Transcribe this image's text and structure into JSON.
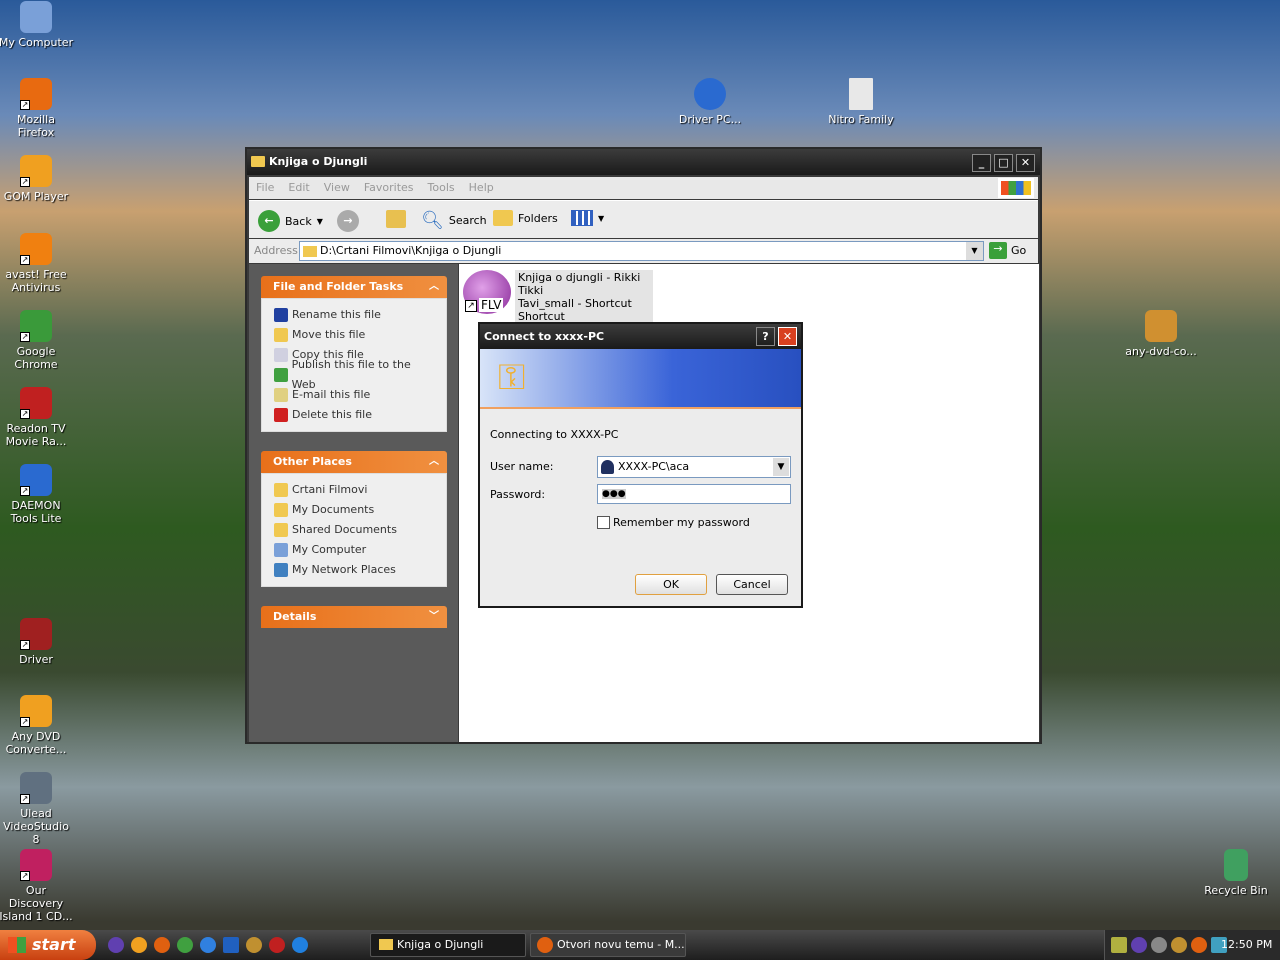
{
  "desktop": {
    "left_icons": [
      {
        "label": "My Computer",
        "color": "#7aa0d8"
      },
      {
        "label": "Mozilla Firefox",
        "color": "#e86a10"
      },
      {
        "label": "GOM Player",
        "color": "#f0a020"
      },
      {
        "label": "avast! Free Antivirus",
        "color": "#f08010"
      },
      {
        "label": "Google Chrome",
        "color": "#3a9a3a"
      },
      {
        "label": "Readon TV Movie Ra...",
        "color": "#c02020"
      },
      {
        "label": "DAEMON Tools Lite",
        "color": "#2a6ad0"
      },
      {
        "label": "Driver",
        "color": "#a02020"
      },
      {
        "label": "Any DVD Converte...",
        "color": "#f0a020"
      },
      {
        "label": "Ulead VideoStudio 8",
        "color": "#607080"
      },
      {
        "label": "Our Discovery Island 1 CD...",
        "color": "#c02060"
      }
    ],
    "other_icons": [
      {
        "label": "Driver PC...",
        "color": "#2a6ad0"
      },
      {
        "label": "Nitro Family",
        "color": "#e0e0e0"
      },
      {
        "label": "any-dvd-co...",
        "color": "#d09030"
      },
      {
        "label": "Recycle Bin",
        "color": "#40a060"
      }
    ]
  },
  "window": {
    "title": "Knjiga o Djungli",
    "menu": [
      "File",
      "Edit",
      "View",
      "Favorites",
      "Tools",
      "Help"
    ],
    "toolbar": {
      "back": "Back",
      "search": "Search",
      "folders": "Folders"
    },
    "address": {
      "label": "Address",
      "value": "D:\\Crtani Filmovi\\Knjiga o Djungli",
      "go": "Go"
    },
    "tasks": {
      "title": "File and Folder Tasks",
      "items": [
        "Rename this file",
        "Move this file",
        "Copy this file",
        "Publish this file to the Web",
        "E-mail this file",
        "Delete this file"
      ]
    },
    "places": {
      "title": "Other Places",
      "items": [
        "Crtani Filmovi",
        "My Documents",
        "Shared Documents",
        "My Computer",
        "My Network Places"
      ]
    },
    "details": {
      "title": "Details"
    },
    "file": {
      "name_line1": "Knjiga o djungli - Rikki Tikki",
      "name_line2": "Tavi_small - Shortcut",
      "type": "Shortcut",
      "badge": "FLV"
    }
  },
  "dialog": {
    "title": "Connect to xxxx-PC",
    "connecting": "Connecting to XXXX-PC",
    "user_label": "User name:",
    "user_value": "XXXX-PC\\aca",
    "password_label": "Password:",
    "password_value": "●●●",
    "remember": "Remember my password",
    "ok": "OK",
    "cancel": "Cancel",
    "help": "?",
    "close": "✕"
  },
  "taskbar": {
    "start": "start",
    "tasks": [
      {
        "label": "Knjiga o Djungli"
      },
      {
        "label": "Otvori novu temu - M..."
      }
    ],
    "clock": "12:50 PM"
  }
}
